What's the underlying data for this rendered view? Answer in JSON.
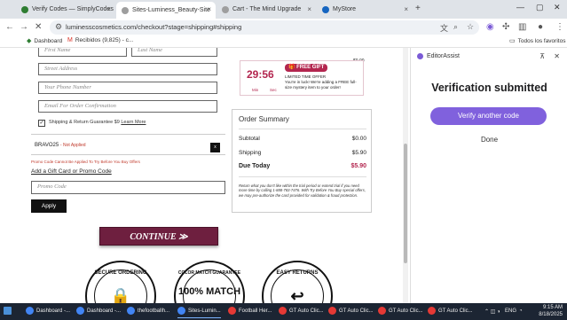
{
  "browser": {
    "tabs": [
      {
        "label": "Verify Codes — SimplyCodes",
        "icon": "check-circle-icon",
        "color": "#2e7d32"
      },
      {
        "label": "Sites-Luminess_Beauty-Site",
        "icon": "site-icon",
        "color": "#5f6368"
      },
      {
        "label": "Cart - The Mind Upgrade",
        "icon": "globe-icon",
        "color": "#5f6368"
      },
      {
        "label": "MyStore",
        "icon": "store-icon",
        "color": "#1565c0"
      }
    ],
    "address": "luminesscosmetics.com/checkout?stage=shipping#shipping",
    "bookmarks": [
      {
        "label": "Dashboard",
        "icon": "dashboard-icon"
      },
      {
        "label": "Recibidos (9,825) - c...",
        "icon": "gmail-icon"
      }
    ],
    "all_bookmarks": "Todos los favoritos"
  },
  "form": {
    "first_name_placeholder": "First Name",
    "last_name_placeholder": "Last Name",
    "street_placeholder": "Street Address",
    "phone_placeholder": "Your Phone Number",
    "email_placeholder": "Email For Order Confirmation",
    "checkbox_mark": "✓",
    "guarantee_text": "Shipping & Return Guarantee $9",
    "learn_more": "Learn More",
    "promo_code": "BRAVO25",
    "promo_status": "- Not Applied",
    "promo_close": "x",
    "promo_error": "Promo Code Cannot Be Applied To Try Before You Buy Offers",
    "gift_link": "Add a Gift Card or Promo Code",
    "promo_input_placeholder": "Promo Code",
    "apply_label": "Apply",
    "continue_label": "CONTINUE ≫"
  },
  "timer": {
    "minutes": "29",
    "seconds": "56",
    "sep": ":",
    "min_label": "Min",
    "sec_label": "Sec",
    "free_gift": "🎁 FREE GIFT",
    "offer_line1": "LIMITED TIME OFFER",
    "offer_line2": "You're in luck! We're adding a FREE full-size mystery item to your order!",
    "top_price": "$0.00"
  },
  "summary": {
    "title": "Order Summary",
    "rows": [
      {
        "label": "Subtotal",
        "value": "$0.00"
      },
      {
        "label": "Shipping",
        "value": "$5.90"
      },
      {
        "label": "Due Today",
        "value": "$5.90"
      }
    ],
    "fine_print": "Return what you don't like within the trial period or extend trial if you need more time by calling 1-888-783-7476. With Try Before You Buy special offers, we may pre-authorize the card provided for validation & fraud protection."
  },
  "badges": [
    {
      "top": "SECURE ORDERING",
      "big": ""
    },
    {
      "top": "COLOR MATCH GUARANTEE",
      "big": "100% MATCH"
    },
    {
      "top": "EASY RETURNS",
      "big": ""
    }
  ],
  "side_panel": {
    "title": "EditorAssist",
    "heading": "Verification submitted",
    "verify_another": "Verify another code",
    "done": "Done"
  },
  "taskbar": {
    "items": [
      {
        "label": "Dashboard -...",
        "color": "#4285f4"
      },
      {
        "label": "Dashboard -...",
        "color": "#4285f4"
      },
      {
        "label": "thefootballh...",
        "color": "#4285f4"
      },
      {
        "label": "Sites-Lumin...",
        "color": "#4285f4"
      },
      {
        "label": "Football Her...",
        "color": "#e53935"
      },
      {
        "label": "GT Auto Clic...",
        "color": "#e53935"
      },
      {
        "label": "GT Auto Clic...",
        "color": "#e53935"
      },
      {
        "label": "GT Auto Clic...",
        "color": "#e53935"
      },
      {
        "label": "GT Auto Clic...",
        "color": "#e53935"
      }
    ],
    "lang": "ENG",
    "time": "9:15 AM",
    "date": "8/18/2025"
  }
}
